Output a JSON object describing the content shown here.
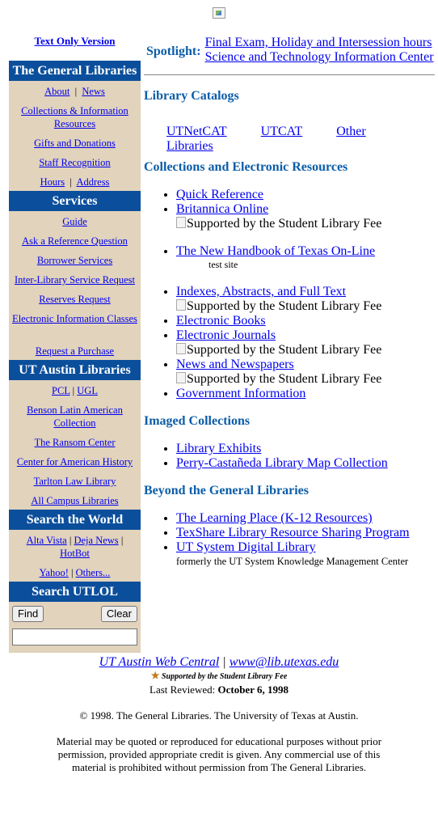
{
  "header": {
    "text_only": "Text Only Version"
  },
  "sidebar": {
    "general_libraries_title": "The General Libraries",
    "about": "About",
    "news": "News",
    "collections": "Collections & Information Resources",
    "gifts": "Gifts and Donations",
    "staff": "Staff Recognition",
    "hours": "Hours",
    "address": "Address",
    "services_title": "Services",
    "services": [
      "Guide",
      "Ask a Reference Question",
      "Borrower Services",
      "Inter-Library Service Request",
      "Reserves Request",
      "Electronic Information Classes",
      "Request a Purchase"
    ],
    "ut_libraries_title": "UT Austin Libraries",
    "pcl": "PCL",
    "ugl": "UGL",
    "benson": "Benson Latin American Collection",
    "ransom": "The Ransom Center",
    "american_history": "Center for American History",
    "tarlton": "Tarlton Law Library",
    "all_campus": "All Campus Libraries",
    "search_world_title": "Search the World",
    "altavista": "Alta Vista",
    "dejanews": "Deja News",
    "hotbot": "HotBot",
    "yahoo": "Yahoo!",
    "others": "Others...",
    "search_utlol_title": "Search UTLOL",
    "find_button": "Find",
    "clear_button": "Clear"
  },
  "spotlight": {
    "label": "Spotlight:",
    "links": [
      "Final Exam, Holiday and Intersession hours",
      "Science and Technology Information Center"
    ]
  },
  "catalogs": {
    "title": "Library Catalogs",
    "links": [
      "UTNetCAT",
      "UTCAT",
      "Other Libraries"
    ]
  },
  "collections": {
    "title": "Collections and Electronic Resources",
    "quick_reference": "Quick Reference",
    "britannica": "Britannica Online",
    "fee_alt": "Supported by the Student Library Fee",
    "handbook": "The New Handbook of Texas On-Line",
    "handbook_note": "test site",
    "indexes": "Indexes, Abstracts, and Full Text",
    "ebooks": "Electronic Books",
    "ejournals": "Electronic Journals",
    "news": "News and Newspapers",
    "government": "Government Information"
  },
  "imaged": {
    "title": "Imaged Collections",
    "links": [
      "Library Exhibits",
      "Perry-Castañeda Library Map Collection"
    ]
  },
  "beyond": {
    "title": "Beyond the General Libraries",
    "learning_place": "The Learning Place (K-12 Resources)",
    "texshare": "TexShare Library Resource Sharing Program",
    "ut_digital": "UT System Digital Library",
    "ut_digital_note": "formerly the UT System Knowledge Management Center"
  },
  "footer": {
    "web_central": "UT Austin Web Central",
    "email": "www@lib.utexas.edu",
    "fee_note": "Supported by the Student Library Fee",
    "reviewed_label": "Last Reviewed:",
    "reviewed_date": "October 6, 1998",
    "copyright": "© 1998. The General Libraries. The University of Texas at Austin.",
    "legal": "Material may be quoted or reproduced for educational purposes without prior permission, provided appropriate credit is given. Any commercial use of this material is prohibited without permission from The General Libraries."
  }
}
